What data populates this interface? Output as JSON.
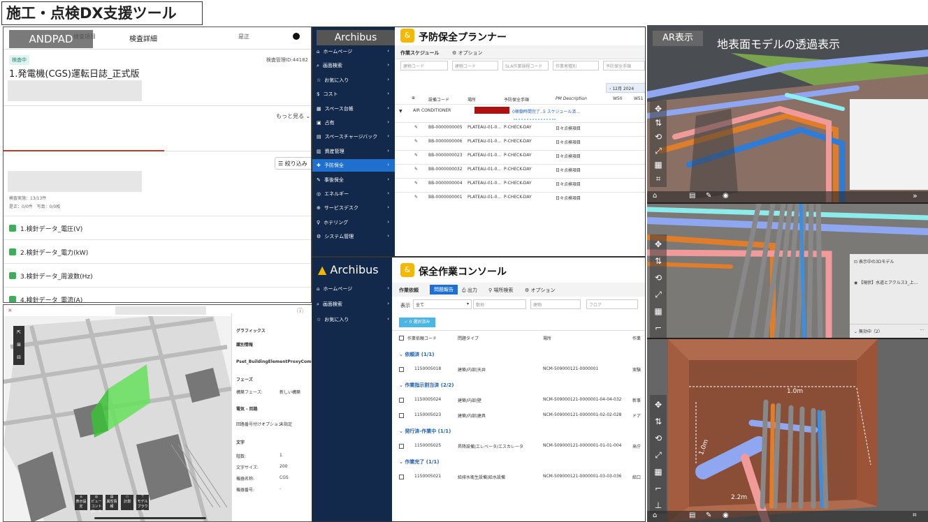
{
  "title": "施工・点検DX支援ツール",
  "andpad": {
    "badge": "ANDPAD",
    "header_title": "検査詳細",
    "status": "検査中",
    "inspection_id": "検査管理ID:44182",
    "doc_title": "1.発電機(CGS)運転日誌_正式版",
    "more": "もっと見る",
    "tabs": [
      "検査項目",
      "是正"
    ],
    "filter": "絞り込み",
    "progress": "検査実施：13/13件",
    "counts": "是正：0/0件　写真：0/0枚",
    "items": [
      "1.検針データ_電圧(V)",
      "2.検針データ_電力(kW)",
      "3.検針データ_周波数(Hz)",
      "4.検針データ_電流(A)"
    ]
  },
  "bim": {
    "props": [
      {
        "label": "グラフィックス",
        "value": ""
      },
      {
        "label": "識別情報",
        "value": ""
      },
      {
        "label": "Pset_BuildingElementProxyCommon",
        "value": ""
      },
      {
        "label": "フェーズ",
        "value": ""
      },
      {
        "label": "構築フェーズ:",
        "value": "新しい構築"
      },
      {
        "label": "電気 - 回路",
        "value": ""
      },
      {
        "label": "回路番号付けオプション:",
        "value": "未指定"
      },
      {
        "label": "文字",
        "value": ""
      },
      {
        "label": "階数:",
        "value": "1"
      },
      {
        "label": "文字サイズ:",
        "value": "200"
      },
      {
        "label": "機器名称:",
        "value": "CGS"
      },
      {
        "label": "機器番号:",
        "value": "-"
      }
    ],
    "tools": [
      "表示設定",
      "ビューコントロール",
      "属性情報",
      "計測",
      "モデルブラウザ"
    ]
  },
  "arch1": {
    "badge": "Archibus",
    "app_title": "予防保全プランナー",
    "tabs": [
      "作業スケジュール",
      "オプション"
    ],
    "filters": [
      "建物コード",
      "建物コード",
      "SLA作業規程コード",
      "作業者種別",
      "予防保全手順"
    ],
    "columns": [
      "設備コード",
      "場所",
      "予防保全手順",
      "PM Description"
    ],
    "month": "12月 2024",
    "weeks": [
      "W50",
      "W51"
    ],
    "group_label": "AIR CONDITIONER",
    "group_status": "0稼働時間完了...",
    "group_link": "5 スケジュール済...",
    "rows": [
      {
        "code": "BB-0000000005",
        "loc": "PLATEAU-01-0...",
        "proc": "P-CHECK-DAY",
        "desc": "日々点検項目"
      },
      {
        "code": "BB-0000000006",
        "loc": "PLATEAU-01-0...",
        "proc": "P-CHECK-DAY",
        "desc": "日々点検項目"
      },
      {
        "code": "BB-0000000023",
        "loc": "PLATEAU-01-0...",
        "proc": "P-CHECK-DAY",
        "desc": "日々点検項目"
      },
      {
        "code": "BB-0000000032",
        "loc": "PLATEAU-01-0...",
        "proc": "P-CHECK-DAY",
        "desc": "日々点検項目"
      },
      {
        "code": "BB-0000000004",
        "loc": "PLATEAU-01-0...",
        "proc": "P-CHECK-DAY",
        "desc": "日々点検項目"
      },
      {
        "code": "BB-0000000001",
        "loc": "PLATEAU-01-0...",
        "proc": "P-CHECK-DAY",
        "desc": "日々点検項目"
      }
    ],
    "nav": [
      "ホームページ",
      "画面検索",
      "お気に入り",
      "コスト",
      "スペース台帳",
      "占有",
      "スペースチャージバック",
      "資産管理",
      "予防保全",
      "事後保全",
      "エネルギー",
      "サービスデスク",
      "ホテリング",
      "システム管理"
    ]
  },
  "arch2": {
    "logo": "Archibus",
    "app_title": "保全作業コンソール",
    "tabs": [
      "作業依頼",
      "問題報告",
      "出力",
      "場所検索",
      "オプション"
    ],
    "filter_label": "表示",
    "filter_value": "全て",
    "filters": [
      "敷地",
      "建物",
      "フロア"
    ],
    "selected": "0 選択済み",
    "columns": [
      "作業依頼コード",
      "問題タイプ",
      "場所",
      "作業"
    ],
    "nav": [
      "ホームページ",
      "画面検索",
      "お気に入り"
    ],
    "groups": [
      {
        "label": "依頼済 (1/1)",
        "rows": [
          {
            "code": "1150005018",
            "type": "建築/内部|天井",
            "loc": "NCM-509000121-0000001",
            "extra": "実験"
          }
        ]
      },
      {
        "label": "作業指示割当済 (2/2)",
        "rows": [
          {
            "code": "1150005024",
            "type": "建築/内部|壁",
            "loc": "NCM-509000121-0000001-04-04-032",
            "extra": "新事"
          },
          {
            "code": "1150005023",
            "type": "建築/内部|建具",
            "loc": "NCM-509000121-0000001-02-02-028",
            "extra": "ドア"
          }
        ]
      },
      {
        "label": "発行済-作業中 (1/1)",
        "rows": [
          {
            "code": "1150005025",
            "type": "昇降設備|エレベータ/エスカレータ",
            "loc": "NCM-509000121-0000001-01-01-004",
            "extra": "来庁"
          }
        ]
      },
      {
        "label": "作業完了 (1/1)",
        "rows": [
          {
            "code": "1150005021",
            "type": "給排水衛生設備|給水設備",
            "loc": "NCM-509000121-0000001-03-03-036",
            "extra": "給口"
          }
        ]
      }
    ]
  },
  "ar": {
    "badge": "AR表示",
    "title": "地表面モデルの透過表示",
    "panel_title": "表示中の3Dモデル",
    "panel_item": "【現状】水道とアクルス3_上...",
    "panel_drop": "無効中（2）",
    "dim_top": "1.0m",
    "dim_side": "1.0m",
    "dim_depth": "2.2m"
  }
}
